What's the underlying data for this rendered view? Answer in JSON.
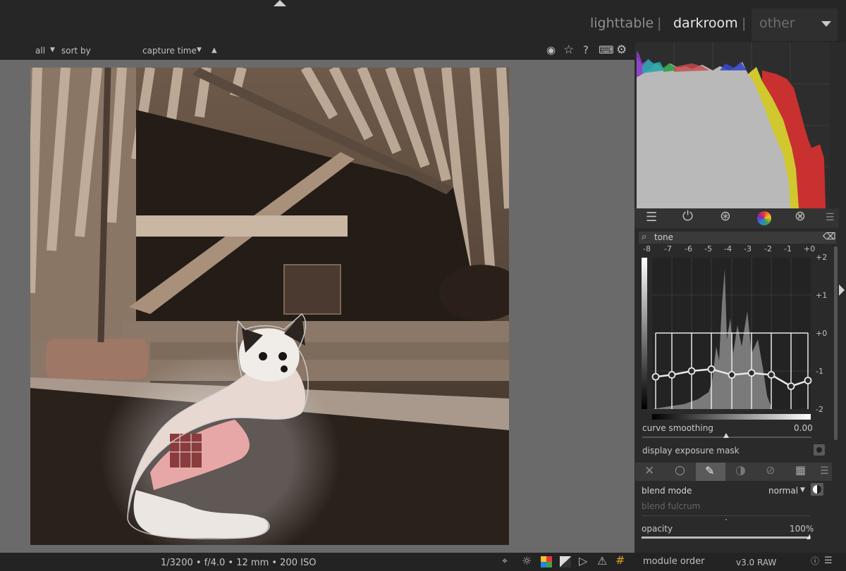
{
  "header": {
    "views": {
      "lighttable": "lighttable",
      "separator": "|",
      "darkroom": "darkroom",
      "other": "other"
    }
  },
  "filterbar": {
    "filter_value": "all",
    "sort_label": "sort by",
    "sort_value": "capture time"
  },
  "status": {
    "exif": "1/3200 • f/4.0 • 12 mm • 200 ISO"
  },
  "module_search": {
    "value": "tone"
  },
  "tone_equalizer": {
    "ev_top_labels": [
      "-8",
      "-7",
      "-6",
      "-5",
      "-4",
      "-3",
      "-2",
      "-1",
      "+0"
    ],
    "ev_right_labels": [
      "+2",
      "+1",
      "+0",
      "-1",
      "-2"
    ],
    "curve_smoothing_label": "curve smoothing",
    "curve_smoothing_value": "0.00",
    "display_exposure_mask_label": "display exposure mask",
    "curve_points": [
      -1.15,
      -1.1,
      -1.0,
      -0.95,
      -1.1,
      -1.05,
      -1.1,
      -1.4,
      -1.25
    ]
  },
  "blending": {
    "blend_mode_label": "blend mode",
    "blend_mode_value": "normal",
    "blend_fulcrum_label": "blend fulcrum",
    "opacity_label": "opacity",
    "opacity_value": "100%"
  },
  "footer": {
    "module_order_label": "module order",
    "module_order_value": "v3.0 RAW"
  },
  "icons": [
    "color-picker-icon",
    "star-icon",
    "help-icon",
    "keyboard-icon",
    "gear-icon",
    "presets-icon",
    "power-icon",
    "tone-icon",
    "color-icon",
    "correct-icon",
    "menu-icon",
    "clear-icon",
    "search-icon"
  ]
}
